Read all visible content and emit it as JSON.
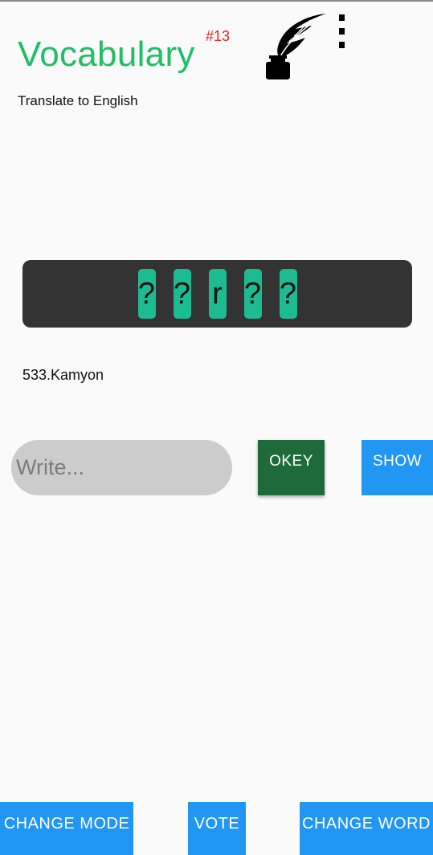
{
  "header": {
    "title": "Vocabulary",
    "level_badge": "#13",
    "subtitle": "Translate to English",
    "logo_icon": "quill-inkwell-icon",
    "menu_icon": "overflow-menu-icon"
  },
  "puzzle": {
    "tiles": [
      "?",
      "?",
      "r",
      "?",
      "?"
    ],
    "word": "533.Kamyon"
  },
  "answer": {
    "placeholder": "Write...",
    "value": "",
    "okey_label": "OKEY",
    "show_label": "SHOW"
  },
  "footer": {
    "change_mode_label": "CHANGE MODE",
    "vote_label": "VOTE",
    "change_word_label": "CHANGE WORD"
  },
  "colors": {
    "title": "#1fbf63",
    "badge": "#e0241b",
    "panel": "#333333",
    "tile": "#1dbb92",
    "okey": "#1f6a3a",
    "primary": "#2196f3",
    "input_bg": "#cccccc"
  }
}
